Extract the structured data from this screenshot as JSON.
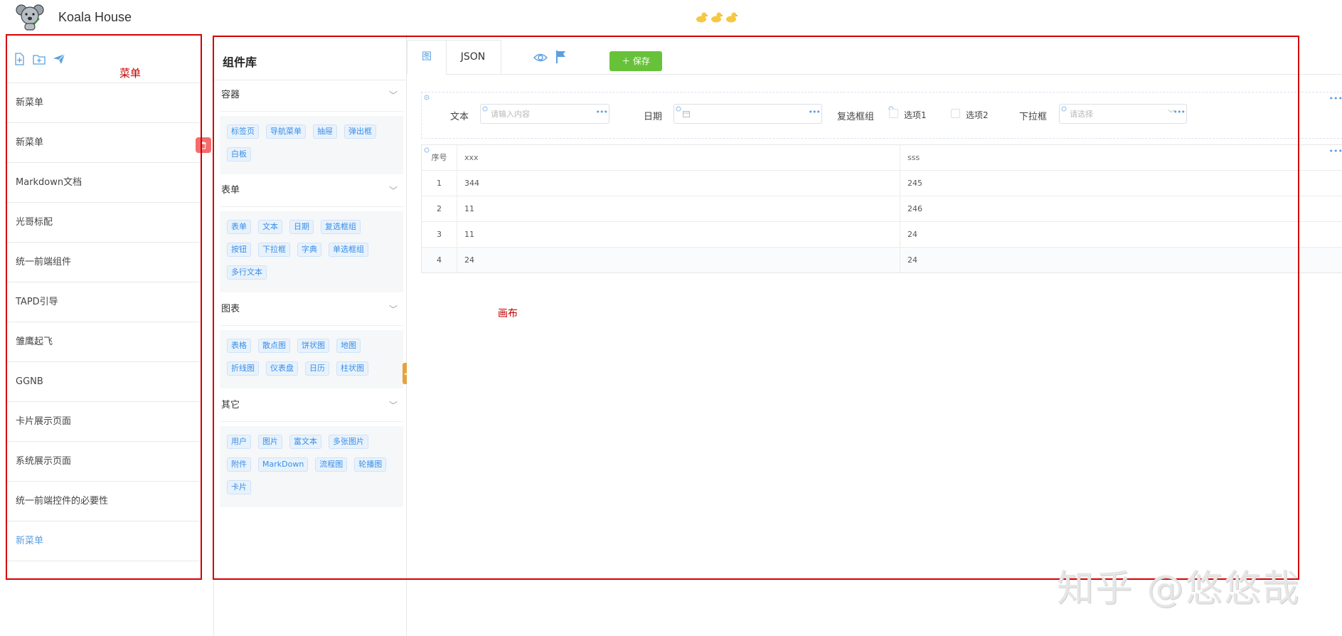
{
  "header": {
    "app_title": "Koala House",
    "logo_icon": "koala-logo-icon",
    "decoration_icons": [
      "duck-icon",
      "duck-icon",
      "duck-icon"
    ]
  },
  "menu": {
    "annotation_label": "菜单",
    "toolbar_icons": [
      "new-file-icon",
      "new-folder-icon",
      "send-icon"
    ],
    "items": [
      {
        "label": "新菜单"
      },
      {
        "label": "新菜单"
      },
      {
        "label": "Markdown文档"
      },
      {
        "label": "光哥标配"
      },
      {
        "label": "统一前端组件"
      },
      {
        "label": "TAPD引导"
      },
      {
        "label": "雏鹰起飞"
      },
      {
        "label": "GGNB"
      },
      {
        "label": "卡片展示页面"
      },
      {
        "label": "系统展示页面"
      },
      {
        "label": "统一前端控件的必要性"
      },
      {
        "label": "新菜单"
      }
    ],
    "active_index": 11,
    "delete_icon": "trash-icon"
  },
  "library": {
    "title": "组件库",
    "sections": [
      {
        "title": "容器",
        "chips": [
          "标签页",
          "导航菜单",
          "抽屉",
          "弹出框",
          "白板"
        ]
      },
      {
        "title": "表单",
        "chips": [
          "表单",
          "文本",
          "日期",
          "复选框组",
          "按钮",
          "下拉框",
          "字典",
          "单选框组",
          "多行文本"
        ]
      },
      {
        "title": "图表",
        "chips": [
          "表格",
          "散点图",
          "饼状图",
          "地图",
          "折线图",
          "仪表盘",
          "日历",
          "柱状图"
        ]
      },
      {
        "title": "其它",
        "chips": [
          "用户",
          "图片",
          "富文本",
          "多张图片",
          "附件",
          "MarkDown",
          "流程图",
          "轮播图",
          "卡片"
        ]
      }
    ],
    "collapse_glyph": "<"
  },
  "editor": {
    "tabs": {
      "graph": "图",
      "json": "JSON"
    },
    "save_label": "保存",
    "form": {
      "text_label": "文本",
      "text_placeholder": "请输入内容",
      "date_label": "日期",
      "checkbox_group_label": "复选框组",
      "option1": "选项1",
      "option2": "选项2",
      "select_label": "下拉框",
      "select_placeholder": "请选择"
    },
    "table": {
      "headers": [
        "序号",
        "xxx",
        "sss"
      ],
      "rows": [
        [
          "1",
          "344",
          "245"
        ],
        [
          "2",
          "11",
          "246"
        ],
        [
          "3",
          "11",
          "24"
        ],
        [
          "4",
          "24",
          "24"
        ]
      ]
    },
    "canvas_annotation": "画布"
  },
  "watermark": "知乎 @悠悠哉",
  "colors": {
    "accent": "#5aa0e0",
    "save_button": "#67c23a",
    "delete_button": "#f56c6c",
    "annotation_red": "#d40000",
    "collapse_tab": "#e6a23c"
  }
}
